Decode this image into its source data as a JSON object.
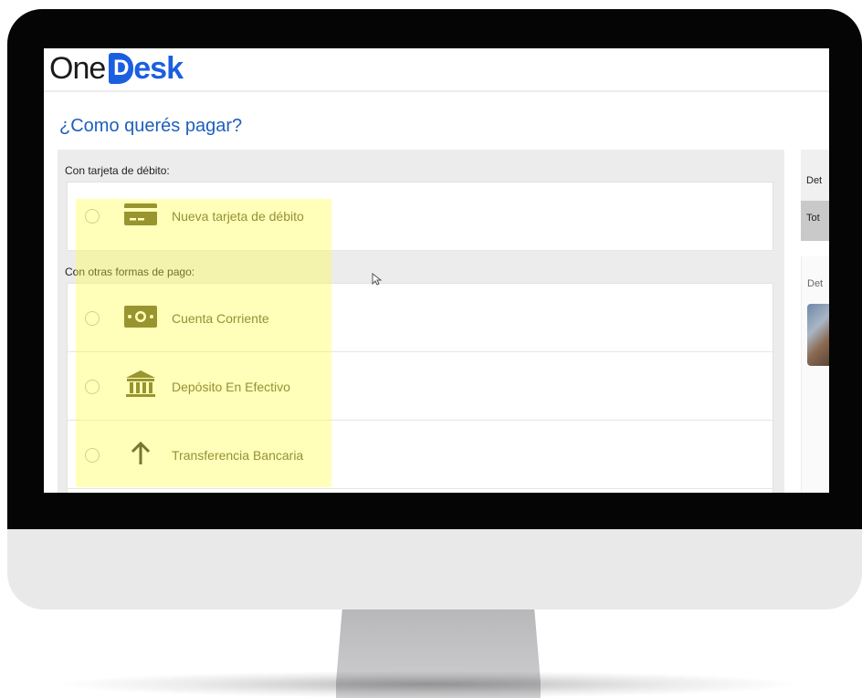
{
  "logo": {
    "one": "One",
    "mark": "D",
    "desk": "esk"
  },
  "page": {
    "title": "¿Como querés pagar?"
  },
  "debit_section": {
    "label": "Con tarjeta de débito:",
    "options": [
      {
        "label": "Nueva tarjeta de débito",
        "icon": "credit-card-icon"
      }
    ]
  },
  "other_section": {
    "label": "Con otras formas de pago:",
    "options": [
      {
        "label": "Cuenta Corriente",
        "icon": "cash-icon"
      },
      {
        "label": "Depósito En Efectivo",
        "icon": "bank-icon"
      },
      {
        "label": "Transferencia Bancaria",
        "icon": "arrow-up-icon"
      }
    ]
  },
  "side": {
    "detail_header": "Det",
    "total": "Tot",
    "detail2": "Det"
  },
  "colors": {
    "brand": "#1a5fe0",
    "title": "#1f5fbd",
    "highlight": "#ffff3c",
    "icon": "#5e5a2a"
  }
}
